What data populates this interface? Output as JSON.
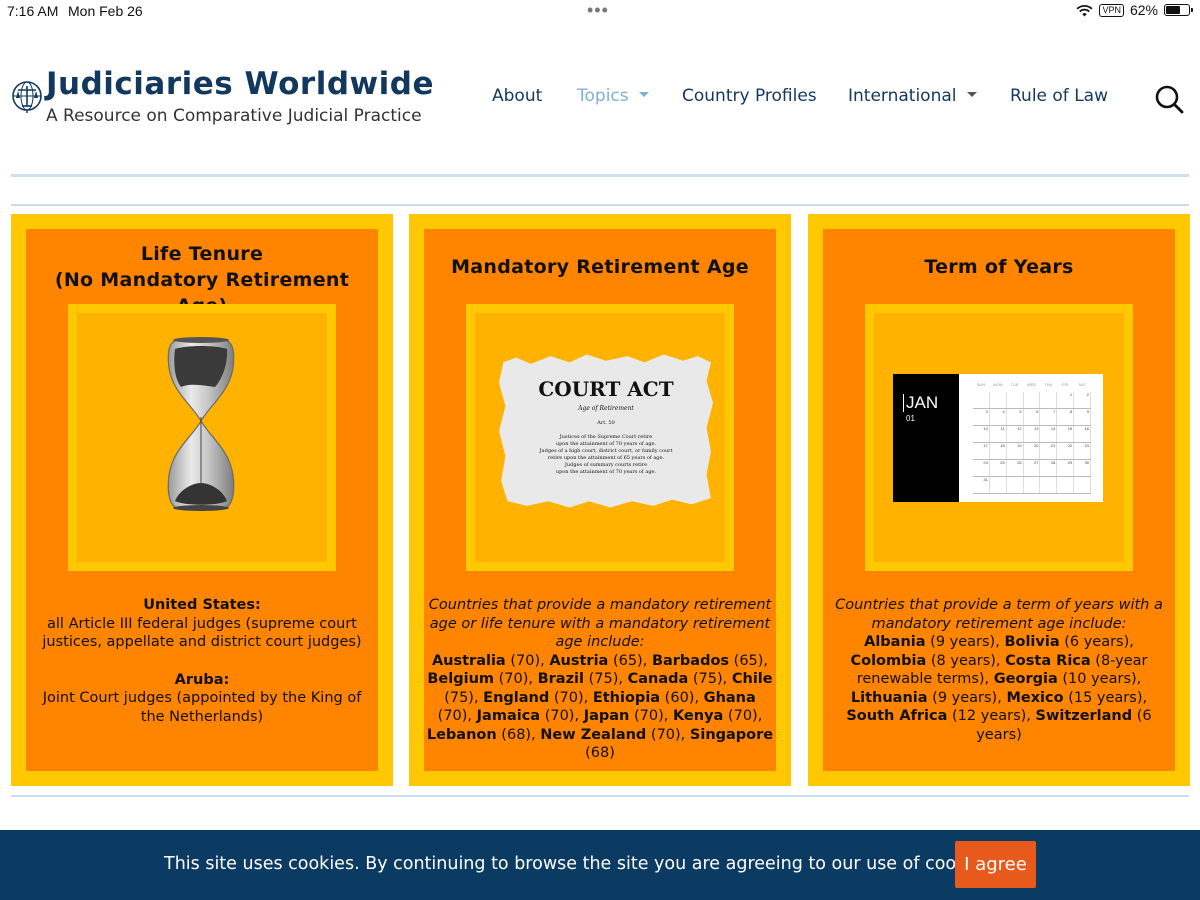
{
  "status_bar": {
    "time": "7:16 AM",
    "date": "Mon Feb 26",
    "vpn": "VPN",
    "battery": "62%",
    "battery_level": 0.62
  },
  "site": {
    "title": "Judiciaries Worldwide",
    "subtitle": "A Resource on Comparative Judicial Practice"
  },
  "nav": {
    "about": "About",
    "topics": "Topics",
    "country_profiles": "Country Profiles",
    "international": "International",
    "rule_of_law": "Rule of Law"
  },
  "colors": {
    "brand_navy": "#12385e",
    "active_nav": "#7db2d8",
    "card_border": "#ffc800",
    "card_bg": "#ff8400",
    "cookie_bar": "#0b3a63",
    "agree_button": "#e8591c"
  },
  "cards": {
    "life_tenure": {
      "title_line1": "Life Tenure",
      "title_line2": "(No Mandatory Retirement Age)",
      "image_icon": "hourglass-icon",
      "us_label": "United States:",
      "us_text": "all Article III federal judges (supreme court justices, appellate and district court judges)",
      "aruba_label": "Aruba:",
      "aruba_text": "Joint Court judges (appointed by the King of the Netherlands)"
    },
    "mandatory_retirement": {
      "title": "Mandatory Retirement Age",
      "paper": {
        "heading": "COURT ACT",
        "subheading": "Age of Retirement",
        "article": "Art. 50",
        "line1": "Justices of the Supreme Court retire",
        "line2": "upon the attainment of 70 years of age.",
        "line3": "Judges of a high court, district court, or family court",
        "line4": "retire upon the attainment of 65 years of age.",
        "line5": "Judges of summary courts retire",
        "line6": "upon the attainment of 70 years of age."
      },
      "intro": "Countries that provide a mandatory retirement age or life tenure with a mandatory retirement age include:",
      "countries": [
        {
          "name": "Australia",
          "value": "(70)"
        },
        {
          "name": "Austria",
          "value": "(65)"
        },
        {
          "name": "Barbados",
          "value": "(65)"
        },
        {
          "name": "Belgium",
          "value": "(70)"
        },
        {
          "name": "Brazil",
          "value": "(75)"
        },
        {
          "name": "Canada",
          "value": "(75)"
        },
        {
          "name": "Chile",
          "value": "(75)"
        },
        {
          "name": "England",
          "value": "(70)"
        },
        {
          "name": "Ethiopia",
          "value": "(60)"
        },
        {
          "name": "Ghana",
          "value": "(70)"
        },
        {
          "name": "Jamaica",
          "value": "(70)"
        },
        {
          "name": "Japan",
          "value": "(70)"
        },
        {
          "name": "Kenya",
          "value": "(70)"
        },
        {
          "name": "Lebanon",
          "value": "(68)"
        },
        {
          "name": "New Zealand",
          "value": "(70)"
        },
        {
          "name": "Singapore",
          "value": "(68)"
        }
      ]
    },
    "term_of_years": {
      "title": "Term of Years",
      "calendar": {
        "month": "JAN",
        "number": "01",
        "weekdays": [
          "SUN",
          "MON",
          "TUE",
          "WED",
          "THU",
          "FRI",
          "SAT"
        ],
        "rows": [
          [
            "",
            "",
            "",
            "",
            "",
            "1",
            "2"
          ],
          [
            "3",
            "4",
            "5",
            "6",
            "7",
            "8",
            "9"
          ],
          [
            "10",
            "11",
            "12",
            "13",
            "14",
            "15",
            "16"
          ],
          [
            "17",
            "18",
            "19",
            "20",
            "21",
            "22",
            "23"
          ],
          [
            "24",
            "25",
            "26",
            "27",
            "28",
            "29",
            "30"
          ],
          [
            "31",
            "",
            "",
            "",
            "",
            "",
            ""
          ]
        ]
      },
      "intro": "Countries that provide a term of years with a mandatory retirement age include:",
      "countries": [
        {
          "name": "Albania",
          "value": "(9 years)"
        },
        {
          "name": "Bolivia",
          "value": "(6 years)"
        },
        {
          "name": "Colombia",
          "value": "(8 years)"
        },
        {
          "name": "Costa Rica",
          "value": "(8-year renewable terms)"
        },
        {
          "name": "Georgia",
          "value": "(10 years)"
        },
        {
          "name": "Lithuania",
          "value": "(9 years)"
        },
        {
          "name": "Mexico",
          "value": "(15 years)"
        },
        {
          "name": "South Africa",
          "value": "(12 years)"
        },
        {
          "name": "Switzerland",
          "value": "(6 years)"
        }
      ]
    }
  },
  "cookie": {
    "text": "This site uses cookies. By continuing to browse the site you are agreeing to our use of cookies.",
    "button": "I agree"
  }
}
